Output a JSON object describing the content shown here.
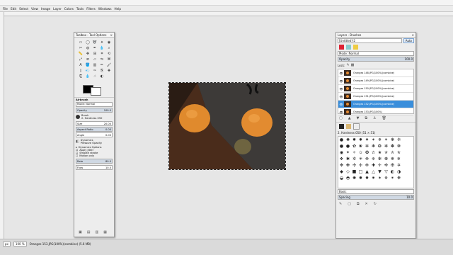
{
  "menubar": [
    "File",
    "Edit",
    "Select",
    "View",
    "Image",
    "Layer",
    "Colors",
    "Tools",
    "Filters",
    "Windows",
    "Help"
  ],
  "toolbox": {
    "title": "Toolbox - Tool Options",
    "tool_icons": [
      "rect-select-icon",
      "ellipse-select-icon",
      "free-select-icon",
      "fuzzy-select-icon",
      "color-select-icon",
      "scissors-icon",
      "foreground-select-icon",
      "paths-icon",
      "color-picker-icon",
      "zoom-icon",
      "measure-icon",
      "move-icon",
      "align-icon",
      "crop-icon",
      "rotate-icon",
      "scale-icon",
      "shear-icon",
      "perspective-icon",
      "flip-icon",
      "cage-icon",
      "text-icon",
      "bucket-fill-icon",
      "blend-icon",
      "pencil-icon",
      "paintbrush-icon",
      "eraser-icon",
      "airbrush-icon",
      "ink-icon",
      "clone-icon",
      "heal-icon",
      "perspective-clone-icon",
      "blur-icon",
      "smudge-icon",
      "dodge-burn-icon"
    ],
    "options_title": "Airbrush",
    "mode_label": "Mode: Normal",
    "opacity_label": "Opacity",
    "opacity_value": "100.0",
    "brush_label": "Brush",
    "brush_name": "2. Hardness 050",
    "size_label": "Size",
    "size_value": "20.00",
    "aspect_label": "Aspect Ratio",
    "aspect_value": "0.00",
    "angle_label": "Angle",
    "angle_value": "0.00",
    "dynamics_label": "Dynamics",
    "dynamics_name": "Pressure Opacity",
    "dynamics_options": "Dynamics Options",
    "apply_jitter": "Apply Jitter",
    "smooth_stroke": "Smooth stroke",
    "motion_only": "Motion only",
    "rate_label": "Rate",
    "rate_value": "80.0",
    "flow_label": "Flow",
    "flow_value": "10.0"
  },
  "layers": {
    "title": "Layers - Brushes",
    "image_select": "[Untitled]-2",
    "auto_label": "Auto",
    "mode_label": "Mode: Normal",
    "opacity_label": "Opacity",
    "opacity_value": "100.0",
    "lock_label": "Lock:",
    "rows": [
      {
        "name": "Oranges 148.JPG(100%)(combine)",
        "selected": false
      },
      {
        "name": "Oranges 149.JPG(100%)(combine)",
        "selected": false
      },
      {
        "name": "Oranges 150.JPG(100%)(combine)",
        "selected": false
      },
      {
        "name": "Oranges 151.JPG(100%)(combine)",
        "selected": false
      },
      {
        "name": "Oranges 152.JPG(100%)(combine)",
        "selected": true
      },
      {
        "name": "Oranges 153.JPG(100%)",
        "selected": false
      }
    ],
    "brushes_header": "2. Hardness 050 (51 × 51)",
    "brushes_tag": "Basic",
    "spacing_label": "Spacing",
    "spacing_value": "10.0"
  },
  "status": {
    "unit": "px",
    "zoom": "100 %",
    "info": "Oranges 153.JPG(100%)(combine) (5.6 MB)"
  },
  "colors": {
    "accent": "#3a8edb",
    "orange": "#e48a32",
    "table": "#3b2a1f"
  }
}
